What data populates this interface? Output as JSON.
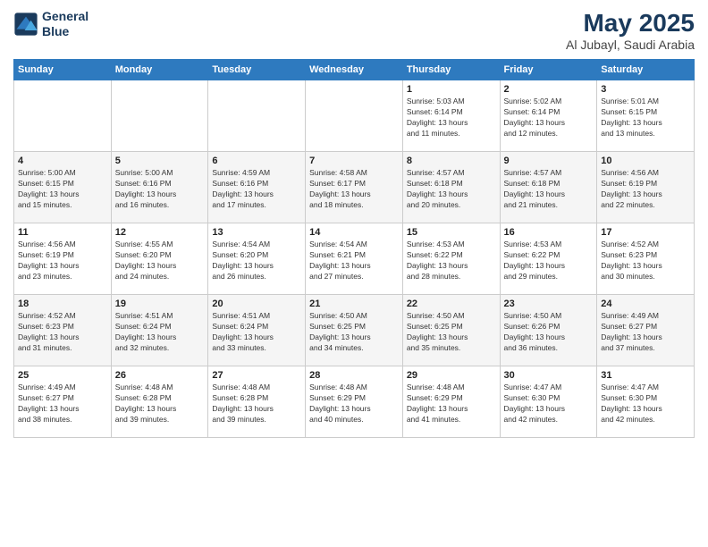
{
  "header": {
    "logo_line1": "General",
    "logo_line2": "Blue",
    "title": "May 2025",
    "subtitle": "Al Jubayl, Saudi Arabia"
  },
  "calendar": {
    "days_of_week": [
      "Sunday",
      "Monday",
      "Tuesday",
      "Wednesday",
      "Thursday",
      "Friday",
      "Saturday"
    ],
    "weeks": [
      {
        "days": [
          {
            "num": "",
            "info": ""
          },
          {
            "num": "",
            "info": ""
          },
          {
            "num": "",
            "info": ""
          },
          {
            "num": "",
            "info": ""
          },
          {
            "num": "1",
            "info": "Sunrise: 5:03 AM\nSunset: 6:14 PM\nDaylight: 13 hours\nand 11 minutes."
          },
          {
            "num": "2",
            "info": "Sunrise: 5:02 AM\nSunset: 6:14 PM\nDaylight: 13 hours\nand 12 minutes."
          },
          {
            "num": "3",
            "info": "Sunrise: 5:01 AM\nSunset: 6:15 PM\nDaylight: 13 hours\nand 13 minutes."
          }
        ]
      },
      {
        "days": [
          {
            "num": "4",
            "info": "Sunrise: 5:00 AM\nSunset: 6:15 PM\nDaylight: 13 hours\nand 15 minutes."
          },
          {
            "num": "5",
            "info": "Sunrise: 5:00 AM\nSunset: 6:16 PM\nDaylight: 13 hours\nand 16 minutes."
          },
          {
            "num": "6",
            "info": "Sunrise: 4:59 AM\nSunset: 6:16 PM\nDaylight: 13 hours\nand 17 minutes."
          },
          {
            "num": "7",
            "info": "Sunrise: 4:58 AM\nSunset: 6:17 PM\nDaylight: 13 hours\nand 18 minutes."
          },
          {
            "num": "8",
            "info": "Sunrise: 4:57 AM\nSunset: 6:18 PM\nDaylight: 13 hours\nand 20 minutes."
          },
          {
            "num": "9",
            "info": "Sunrise: 4:57 AM\nSunset: 6:18 PM\nDaylight: 13 hours\nand 21 minutes."
          },
          {
            "num": "10",
            "info": "Sunrise: 4:56 AM\nSunset: 6:19 PM\nDaylight: 13 hours\nand 22 minutes."
          }
        ]
      },
      {
        "days": [
          {
            "num": "11",
            "info": "Sunrise: 4:56 AM\nSunset: 6:19 PM\nDaylight: 13 hours\nand 23 minutes."
          },
          {
            "num": "12",
            "info": "Sunrise: 4:55 AM\nSunset: 6:20 PM\nDaylight: 13 hours\nand 24 minutes."
          },
          {
            "num": "13",
            "info": "Sunrise: 4:54 AM\nSunset: 6:20 PM\nDaylight: 13 hours\nand 26 minutes."
          },
          {
            "num": "14",
            "info": "Sunrise: 4:54 AM\nSunset: 6:21 PM\nDaylight: 13 hours\nand 27 minutes."
          },
          {
            "num": "15",
            "info": "Sunrise: 4:53 AM\nSunset: 6:22 PM\nDaylight: 13 hours\nand 28 minutes."
          },
          {
            "num": "16",
            "info": "Sunrise: 4:53 AM\nSunset: 6:22 PM\nDaylight: 13 hours\nand 29 minutes."
          },
          {
            "num": "17",
            "info": "Sunrise: 4:52 AM\nSunset: 6:23 PM\nDaylight: 13 hours\nand 30 minutes."
          }
        ]
      },
      {
        "days": [
          {
            "num": "18",
            "info": "Sunrise: 4:52 AM\nSunset: 6:23 PM\nDaylight: 13 hours\nand 31 minutes."
          },
          {
            "num": "19",
            "info": "Sunrise: 4:51 AM\nSunset: 6:24 PM\nDaylight: 13 hours\nand 32 minutes."
          },
          {
            "num": "20",
            "info": "Sunrise: 4:51 AM\nSunset: 6:24 PM\nDaylight: 13 hours\nand 33 minutes."
          },
          {
            "num": "21",
            "info": "Sunrise: 4:50 AM\nSunset: 6:25 PM\nDaylight: 13 hours\nand 34 minutes."
          },
          {
            "num": "22",
            "info": "Sunrise: 4:50 AM\nSunset: 6:25 PM\nDaylight: 13 hours\nand 35 minutes."
          },
          {
            "num": "23",
            "info": "Sunrise: 4:50 AM\nSunset: 6:26 PM\nDaylight: 13 hours\nand 36 minutes."
          },
          {
            "num": "24",
            "info": "Sunrise: 4:49 AM\nSunset: 6:27 PM\nDaylight: 13 hours\nand 37 minutes."
          }
        ]
      },
      {
        "days": [
          {
            "num": "25",
            "info": "Sunrise: 4:49 AM\nSunset: 6:27 PM\nDaylight: 13 hours\nand 38 minutes."
          },
          {
            "num": "26",
            "info": "Sunrise: 4:48 AM\nSunset: 6:28 PM\nDaylight: 13 hours\nand 39 minutes."
          },
          {
            "num": "27",
            "info": "Sunrise: 4:48 AM\nSunset: 6:28 PM\nDaylight: 13 hours\nand 39 minutes."
          },
          {
            "num": "28",
            "info": "Sunrise: 4:48 AM\nSunset: 6:29 PM\nDaylight: 13 hours\nand 40 minutes."
          },
          {
            "num": "29",
            "info": "Sunrise: 4:48 AM\nSunset: 6:29 PM\nDaylight: 13 hours\nand 41 minutes."
          },
          {
            "num": "30",
            "info": "Sunrise: 4:47 AM\nSunset: 6:30 PM\nDaylight: 13 hours\nand 42 minutes."
          },
          {
            "num": "31",
            "info": "Sunrise: 4:47 AM\nSunset: 6:30 PM\nDaylight: 13 hours\nand 42 minutes."
          }
        ]
      }
    ]
  }
}
